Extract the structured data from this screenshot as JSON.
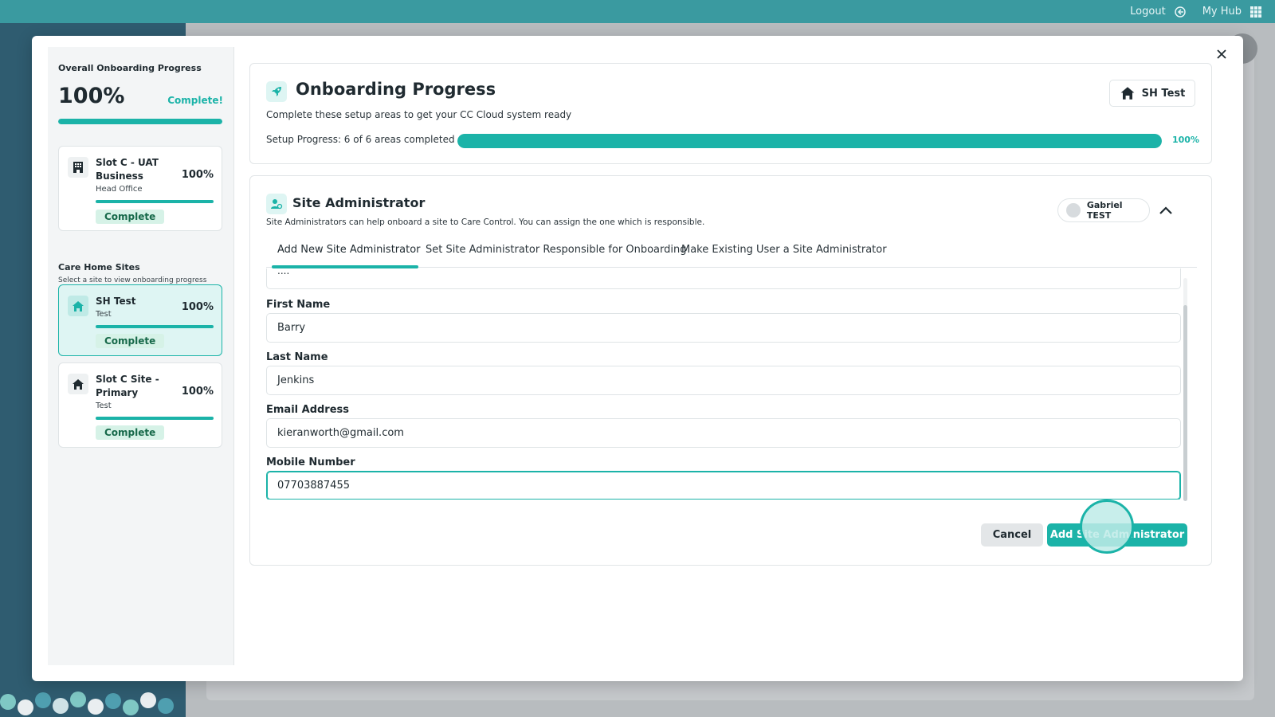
{
  "topbar": {
    "logout_label": "Logout",
    "hub_label": "My Hub"
  },
  "overall": {
    "label": "Overall Onboarding Progress",
    "percent": "100%",
    "status": "Complete!",
    "progress": 1.0
  },
  "business": {
    "name": "Slot C - UAT Business",
    "subtitle": "Head Office",
    "percent": "100%",
    "badge": "Complete",
    "progress": 1.0
  },
  "care_home": {
    "label": "Care Home Sites",
    "sub": "Select a site to view onboarding progress",
    "sites": [
      {
        "name": "SH Test",
        "subtitle": "Test",
        "percent": "100%",
        "badge": "Complete",
        "progress": 1.0,
        "active": true
      },
      {
        "name": "Slot C Site - Primary",
        "subtitle": "Test",
        "percent": "100%",
        "badge": "Complete",
        "progress": 1.0,
        "active": false
      }
    ]
  },
  "onboarding": {
    "title": "Onboarding Progress",
    "subtitle": "Complete these setup areas to get your CC Cloud system ready",
    "setup_text": "Setup Progress: 6 of 6 areas completed",
    "percent": "100%",
    "progress": 1.0,
    "site_button": "SH Test"
  },
  "admin": {
    "title": "Site Administrator",
    "subtitle": "Site Administrators can help onboard a site to Care Control. You can assign the one which is responsible.",
    "assigned_user": "Gabriel TEST",
    "tabs": [
      "Add New Site Administrator",
      "Set Site Administrator Responsible for Onboarding",
      "Make Existing User a Site Administrator"
    ],
    "stub_value": "....",
    "fields": [
      {
        "label": "First Name",
        "value": "Barry"
      },
      {
        "label": "Last Name",
        "value": "Jenkins"
      },
      {
        "label": "Email Address",
        "value": "kieranworth@gmail.com"
      },
      {
        "label": "Mobile Number",
        "value": "07703887455"
      }
    ],
    "cancel_label": "Cancel",
    "add_label": "Add Site Administrator"
  },
  "colors": {
    "accent": "#1bb3a8",
    "topbar": "#3a9aa0",
    "sidebar": "#2f5c70"
  }
}
